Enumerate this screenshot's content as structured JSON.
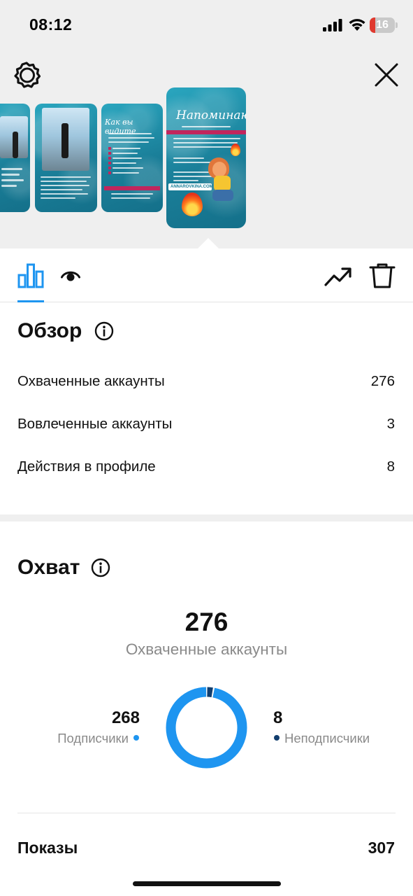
{
  "status_bar": {
    "time": "08:12",
    "battery_level": "16",
    "battery_color": "#e03a2f"
  },
  "header": {
    "left_icon": "settings-gear-icon",
    "right_icon": "close-icon"
  },
  "story_thumbnails": [
    {
      "name": "story-1"
    },
    {
      "name": "story-2"
    },
    {
      "name": "story-3",
      "title": "Как вы видите"
    },
    {
      "name": "story-4-selected",
      "title": "Напоминаю,",
      "link_text": "ANNAROVKINA.COM"
    }
  ],
  "tabs": [
    {
      "name": "insights",
      "icon": "bar-chart-icon",
      "active": true
    },
    {
      "name": "viewers",
      "icon": "eye-icon",
      "active": false
    }
  ],
  "tab_actions": [
    {
      "name": "promote",
      "icon": "trend-up-icon"
    },
    {
      "name": "delete",
      "icon": "trash-icon"
    }
  ],
  "overview": {
    "title": "Обзор",
    "metrics": [
      {
        "label": "Охваченные аккаунты",
        "value": "276"
      },
      {
        "label": "Вовлеченные аккаунты",
        "value": "3"
      },
      {
        "label": "Действия в профиле",
        "value": "8"
      }
    ]
  },
  "reach": {
    "title": "Охват",
    "total": "276",
    "total_label": "Охваченные аккаунты",
    "followers_value": "268",
    "followers_label": "Подписчики",
    "non_followers_value": "8",
    "non_followers_label": "Неподписчики",
    "followers_share": 0.971,
    "colors": {
      "followers": "#1e95f0",
      "non_followers": "#123e6e"
    }
  },
  "impressions": {
    "label": "Показы",
    "value": "307"
  },
  "accent_color": "#1e95f0"
}
